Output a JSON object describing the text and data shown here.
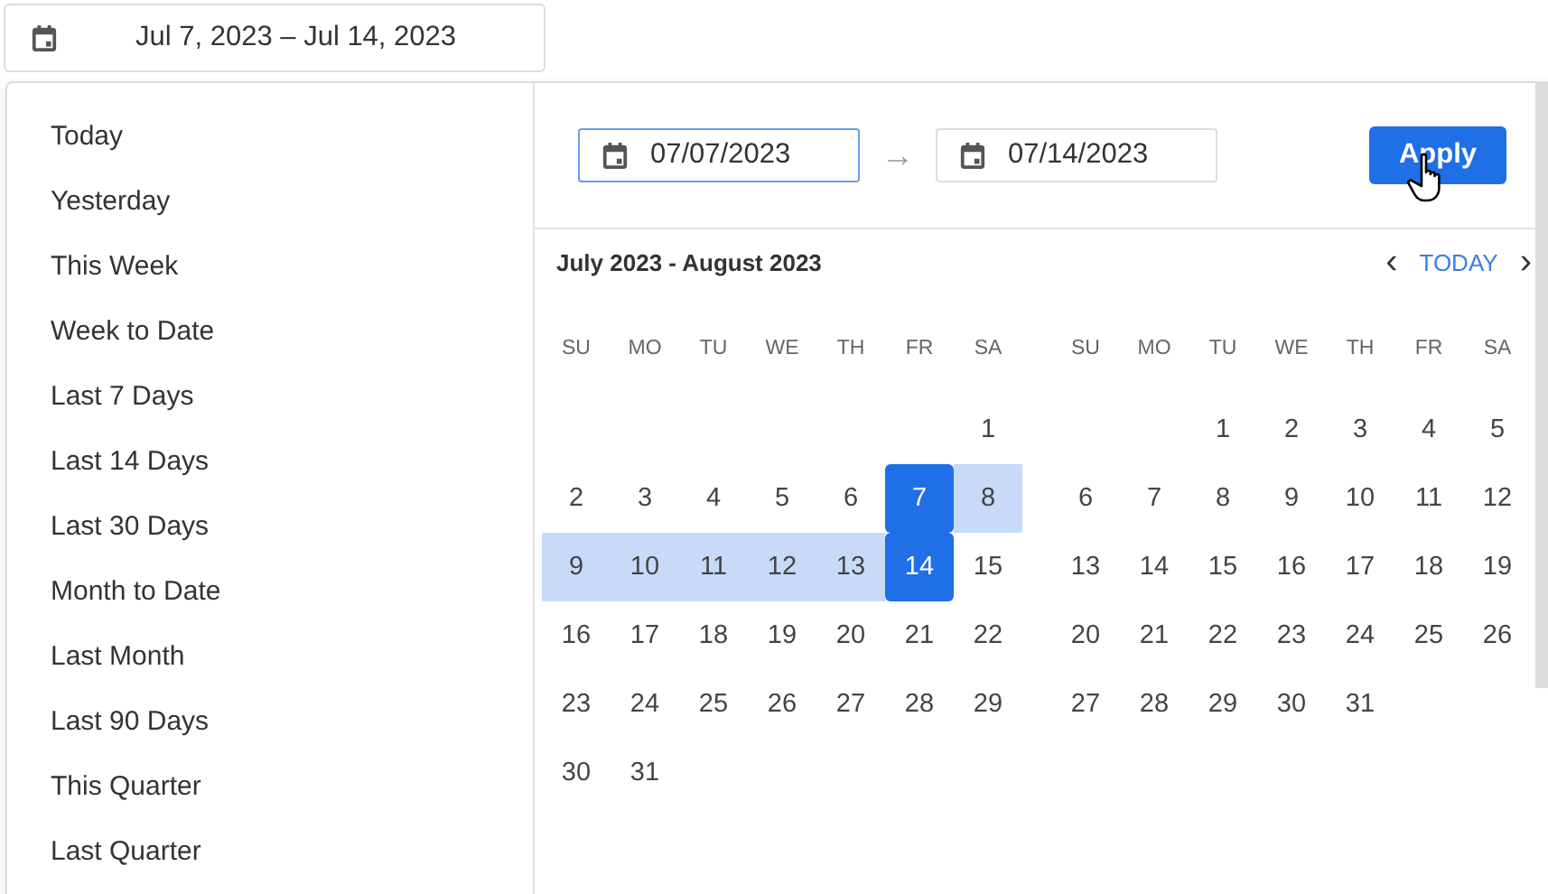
{
  "date_range_button": {
    "label": "Jul 7, 2023 – Jul 14, 2023"
  },
  "presets": [
    {
      "label": "Today"
    },
    {
      "label": "Yesterday"
    },
    {
      "label": "This Week"
    },
    {
      "label": "Week to Date"
    },
    {
      "label": "Last 7 Days"
    },
    {
      "label": "Last 14 Days"
    },
    {
      "label": "Last 30 Days"
    },
    {
      "label": "Month to Date"
    },
    {
      "label": "Last Month"
    },
    {
      "label": "Last 90 Days"
    },
    {
      "label": "This Quarter"
    },
    {
      "label": "Last Quarter"
    }
  ],
  "start_field": {
    "value": "07/07/2023",
    "focused": true
  },
  "arrow": "→",
  "end_field": {
    "value": "07/14/2023",
    "focused": false
  },
  "apply_button": {
    "label": "Apply"
  },
  "calendar_header": {
    "title": "July 2023 - August 2023",
    "prev": "‹",
    "today": "TODAY",
    "next": "›"
  },
  "months": [
    {
      "weekdays": [
        "SU",
        "MO",
        "TU",
        "WE",
        "TH",
        "FR",
        "SA"
      ],
      "weeks": [
        {
          "kind": "first",
          "days": [
            {
              "day": "1",
              "selected": false,
              "in_range": false
            }
          ]
        },
        {
          "kind": "full",
          "days": [
            {
              "day": "2",
              "selected": false,
              "in_range": false
            },
            {
              "day": "3",
              "selected": false,
              "in_range": false
            },
            {
              "day": "4",
              "selected": false,
              "in_range": false
            },
            {
              "day": "5",
              "selected": false,
              "in_range": false
            },
            {
              "day": "6",
              "selected": false,
              "in_range": false
            },
            {
              "day": "7",
              "selected": true,
              "in_range": true
            },
            {
              "day": "8",
              "selected": false,
              "in_range": true
            }
          ]
        },
        {
          "kind": "full",
          "days": [
            {
              "day": "9",
              "selected": false,
              "in_range": true
            },
            {
              "day": "10",
              "selected": false,
              "in_range": true
            },
            {
              "day": "11",
              "selected": false,
              "in_range": true
            },
            {
              "day": "12",
              "selected": false,
              "in_range": true
            },
            {
              "day": "13",
              "selected": false,
              "in_range": true
            },
            {
              "day": "14",
              "selected": true,
              "in_range": true
            },
            {
              "day": "15",
              "selected": false,
              "in_range": false
            }
          ]
        },
        {
          "kind": "full",
          "days": [
            {
              "day": "16",
              "selected": false,
              "in_range": false
            },
            {
              "day": "17",
              "selected": false,
              "in_range": false
            },
            {
              "day": "18",
              "selected": false,
              "in_range": false
            },
            {
              "day": "19",
              "selected": false,
              "in_range": false
            },
            {
              "day": "20",
              "selected": false,
              "in_range": false
            },
            {
              "day": "21",
              "selected": false,
              "in_range": false
            },
            {
              "day": "22",
              "selected": false,
              "in_range": false
            }
          ]
        },
        {
          "kind": "full",
          "days": [
            {
              "day": "23",
              "selected": false,
              "in_range": false
            },
            {
              "day": "24",
              "selected": false,
              "in_range": false
            },
            {
              "day": "25",
              "selected": false,
              "in_range": false
            },
            {
              "day": "26",
              "selected": false,
              "in_range": false
            },
            {
              "day": "27",
              "selected": false,
              "in_range": false
            },
            {
              "day": "28",
              "selected": false,
              "in_range": false
            },
            {
              "day": "29",
              "selected": false,
              "in_range": false
            }
          ]
        },
        {
          "kind": "last",
          "days": [
            {
              "day": "30",
              "selected": false,
              "in_range": false
            },
            {
              "day": "31",
              "selected": false,
              "in_range": false
            }
          ]
        }
      ]
    },
    {
      "weekdays": [
        "SU",
        "MO",
        "TU",
        "WE",
        "TH",
        "FR",
        "SA"
      ],
      "weeks": [
        {
          "kind": "first",
          "days": [
            {
              "day": "1",
              "selected": false,
              "in_range": false
            },
            {
              "day": "2",
              "selected": false,
              "in_range": false
            },
            {
              "day": "3",
              "selected": false,
              "in_range": false
            },
            {
              "day": "4",
              "selected": false,
              "in_range": false
            },
            {
              "day": "5",
              "selected": false,
              "in_range": false
            }
          ]
        },
        {
          "kind": "full",
          "days": [
            {
              "day": "6",
              "selected": false,
              "in_range": false
            },
            {
              "day": "7",
              "selected": false,
              "in_range": false
            },
            {
              "day": "8",
              "selected": false,
              "in_range": false
            },
            {
              "day": "9",
              "selected": false,
              "in_range": false
            },
            {
              "day": "10",
              "selected": false,
              "in_range": false
            },
            {
              "day": "11",
              "selected": false,
              "in_range": false
            },
            {
              "day": "12",
              "selected": false,
              "in_range": false
            }
          ]
        },
        {
          "kind": "full",
          "days": [
            {
              "day": "13",
              "selected": false,
              "in_range": false
            },
            {
              "day": "14",
              "selected": false,
              "in_range": false
            },
            {
              "day": "15",
              "selected": false,
              "in_range": false
            },
            {
              "day": "16",
              "selected": false,
              "in_range": false
            },
            {
              "day": "17",
              "selected": false,
              "in_range": false
            },
            {
              "day": "18",
              "selected": false,
              "in_range": false
            },
            {
              "day": "19",
              "selected": false,
              "in_range": false
            }
          ]
        },
        {
          "kind": "full",
          "days": [
            {
              "day": "20",
              "selected": false,
              "in_range": false
            },
            {
              "day": "21",
              "selected": false,
              "in_range": false
            },
            {
              "day": "22",
              "selected": false,
              "in_range": false
            },
            {
              "day": "23",
              "selected": false,
              "in_range": false
            },
            {
              "day": "24",
              "selected": false,
              "in_range": false
            },
            {
              "day": "25",
              "selected": false,
              "in_range": false
            },
            {
              "day": "26",
              "selected": false,
              "in_range": false
            }
          ]
        },
        {
          "kind": "last",
          "days": [
            {
              "day": "27",
              "selected": false,
              "in_range": false
            },
            {
              "day": "28",
              "selected": false,
              "in_range": false
            },
            {
              "day": "29",
              "selected": false,
              "in_range": false
            },
            {
              "day": "30",
              "selected": false,
              "in_range": false
            },
            {
              "day": "31",
              "selected": false,
              "in_range": false
            }
          ]
        }
      ]
    }
  ]
}
